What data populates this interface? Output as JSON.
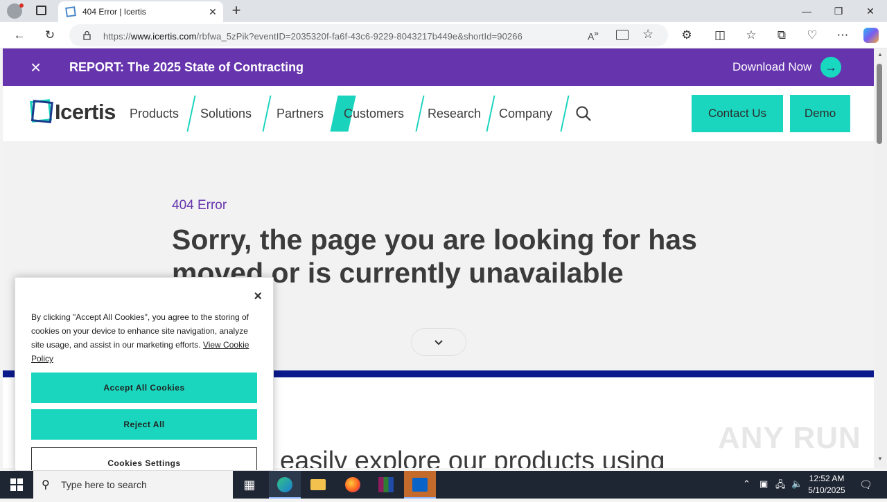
{
  "browser": {
    "tab_title": "404 Error | Icertis",
    "url_prefix": "https://",
    "url_domain": "www.icertis.com",
    "url_path": "/rbfwa_5zPik?eventID=2035320f-fa6f-43c6-9229-8043217b449e&shortId=90266"
  },
  "banner": {
    "close_glyph": "×",
    "text": "REPORT: The 2025 State of Contracting",
    "cta": "Download Now"
  },
  "header": {
    "logo_text": "Icertis",
    "nav": [
      "Products",
      "Solutions",
      "Partners",
      "Customers",
      "Research",
      "Company"
    ],
    "contact_label": "Contact Us",
    "demo_label": "Demo"
  },
  "hero": {
    "eyebrow": "404 Error",
    "headline": "Sorry, the page you are looking for has moved or is currently unavailable",
    "scroll_glyph": "⌄"
  },
  "below": {
    "text": "easily explore our products using"
  },
  "cookie": {
    "close_glyph": "×",
    "body": "By clicking \"Accept All Cookies\", you agree to the storing of cookies on your device to enhance site navigation, analyze site usage, and assist in our marketing efforts.",
    "policy_link": "View Cookie Policy",
    "accept_label": "Accept All Cookies",
    "reject_label": "Reject All",
    "settings_label": "Cookies Settings"
  },
  "taskbar": {
    "search_placeholder": "Type here to search",
    "time": "12:52 AM",
    "date": "5/10/2025"
  },
  "watermark": "ANY RUN",
  "colors": {
    "brand_purple": "#6634ad",
    "brand_teal": "#1ad6be",
    "divider_navy": "#0a1a8c"
  }
}
